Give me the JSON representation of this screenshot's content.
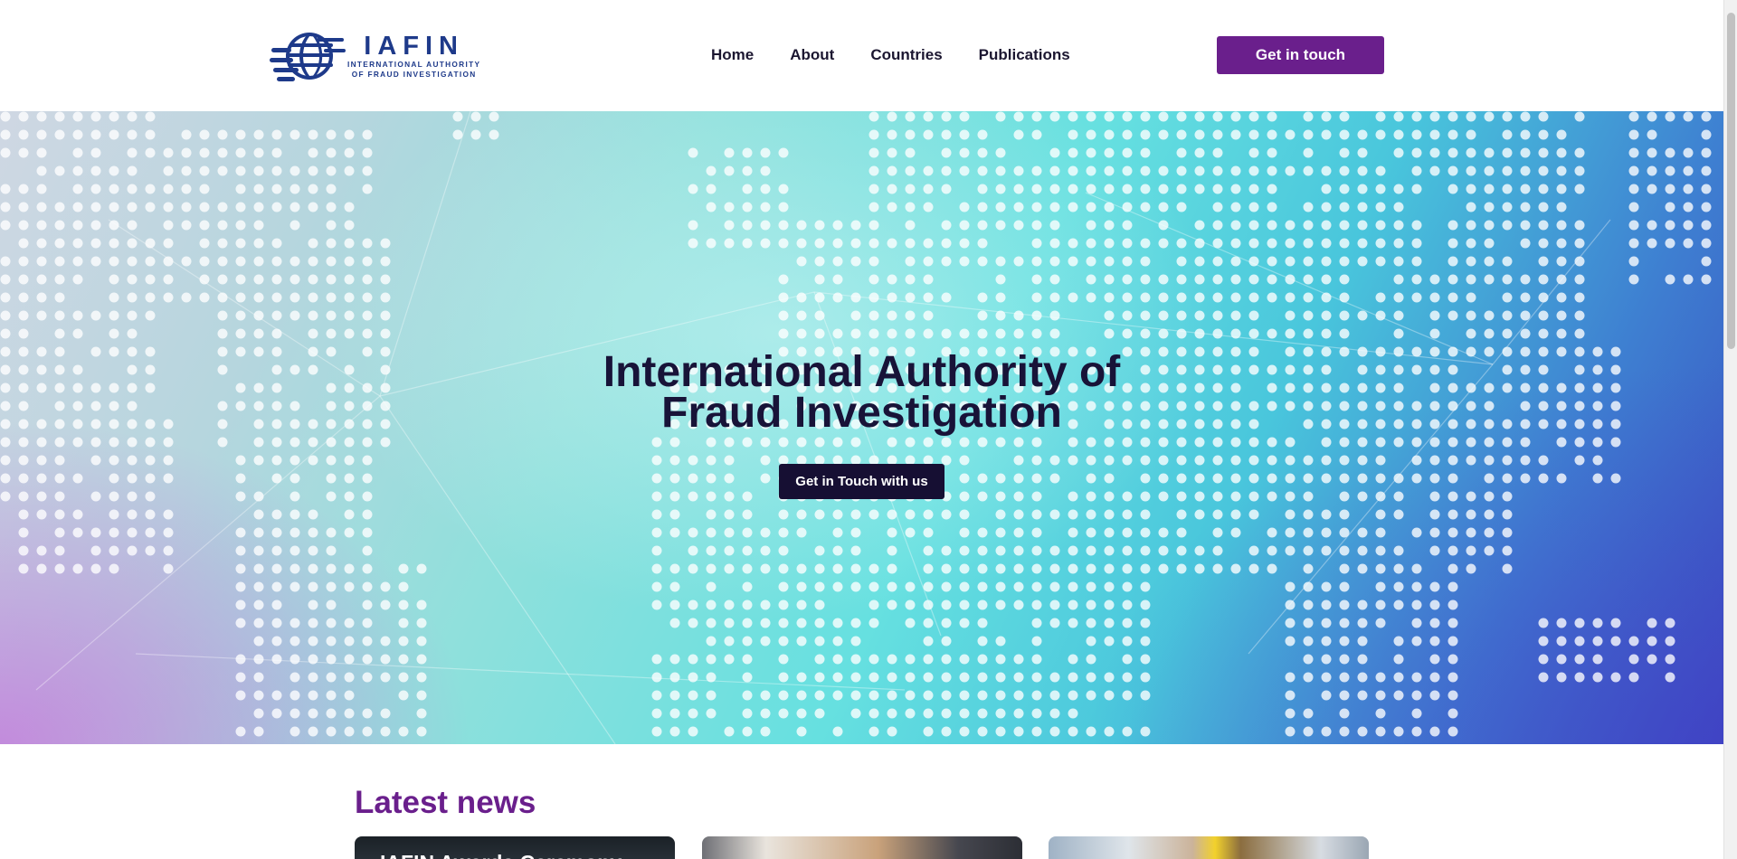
{
  "brand": {
    "name": "IAFIN",
    "subtitle_line1": "INTERNATIONAL AUTHORITY",
    "subtitle_line2": "OF FRAUD INVESTIGATION",
    "color": "#1e3a8a"
  },
  "nav": {
    "items": [
      {
        "label": "Home"
      },
      {
        "label": "About"
      },
      {
        "label": "Countries"
      },
      {
        "label": "Publications"
      }
    ],
    "cta_label": "Get in touch"
  },
  "hero": {
    "title_line1": "International Authority of",
    "title_line2": "Fraud Investigation",
    "button_label": "Get in Touch with us"
  },
  "news": {
    "heading": "Latest news",
    "cards": [
      {
        "title": "IAFIN Awards Ceremony"
      },
      {
        "title": ""
      },
      {
        "title": ""
      }
    ]
  },
  "colors": {
    "accent": "#6a1f8c",
    "hero_button": "#160f33",
    "heading_text": "#181338"
  }
}
